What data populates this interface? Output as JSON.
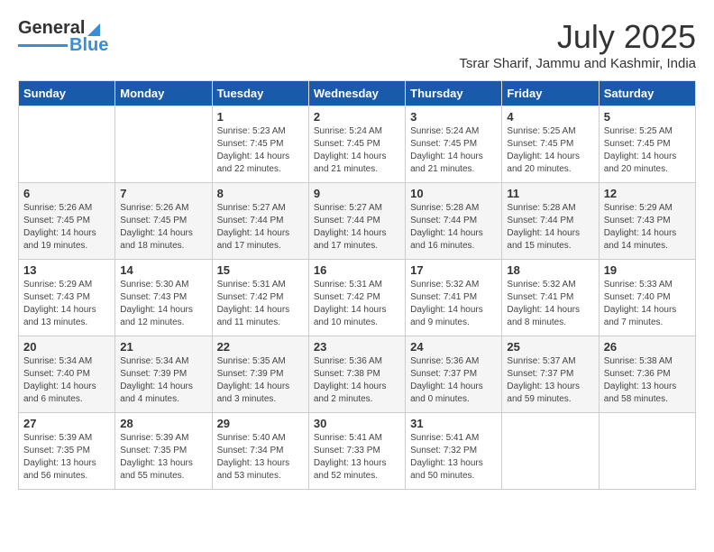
{
  "header": {
    "logo_line1": "General",
    "logo_line2": "Blue",
    "month_year": "July 2025",
    "location": "Tsrar Sharif, Jammu and Kashmir, India"
  },
  "days_of_week": [
    "Sunday",
    "Monday",
    "Tuesday",
    "Wednesday",
    "Thursday",
    "Friday",
    "Saturday"
  ],
  "weeks": [
    [
      {
        "day": "",
        "content": ""
      },
      {
        "day": "",
        "content": ""
      },
      {
        "day": "1",
        "content": "Sunrise: 5:23 AM\nSunset: 7:45 PM\nDaylight: 14 hours\nand 22 minutes."
      },
      {
        "day": "2",
        "content": "Sunrise: 5:24 AM\nSunset: 7:45 PM\nDaylight: 14 hours\nand 21 minutes."
      },
      {
        "day": "3",
        "content": "Sunrise: 5:24 AM\nSunset: 7:45 PM\nDaylight: 14 hours\nand 21 minutes."
      },
      {
        "day": "4",
        "content": "Sunrise: 5:25 AM\nSunset: 7:45 PM\nDaylight: 14 hours\nand 20 minutes."
      },
      {
        "day": "5",
        "content": "Sunrise: 5:25 AM\nSunset: 7:45 PM\nDaylight: 14 hours\nand 20 minutes."
      }
    ],
    [
      {
        "day": "6",
        "content": "Sunrise: 5:26 AM\nSunset: 7:45 PM\nDaylight: 14 hours\nand 19 minutes."
      },
      {
        "day": "7",
        "content": "Sunrise: 5:26 AM\nSunset: 7:45 PM\nDaylight: 14 hours\nand 18 minutes."
      },
      {
        "day": "8",
        "content": "Sunrise: 5:27 AM\nSunset: 7:44 PM\nDaylight: 14 hours\nand 17 minutes."
      },
      {
        "day": "9",
        "content": "Sunrise: 5:27 AM\nSunset: 7:44 PM\nDaylight: 14 hours\nand 17 minutes."
      },
      {
        "day": "10",
        "content": "Sunrise: 5:28 AM\nSunset: 7:44 PM\nDaylight: 14 hours\nand 16 minutes."
      },
      {
        "day": "11",
        "content": "Sunrise: 5:28 AM\nSunset: 7:44 PM\nDaylight: 14 hours\nand 15 minutes."
      },
      {
        "day": "12",
        "content": "Sunrise: 5:29 AM\nSunset: 7:43 PM\nDaylight: 14 hours\nand 14 minutes."
      }
    ],
    [
      {
        "day": "13",
        "content": "Sunrise: 5:29 AM\nSunset: 7:43 PM\nDaylight: 14 hours\nand 13 minutes."
      },
      {
        "day": "14",
        "content": "Sunrise: 5:30 AM\nSunset: 7:43 PM\nDaylight: 14 hours\nand 12 minutes."
      },
      {
        "day": "15",
        "content": "Sunrise: 5:31 AM\nSunset: 7:42 PM\nDaylight: 14 hours\nand 11 minutes."
      },
      {
        "day": "16",
        "content": "Sunrise: 5:31 AM\nSunset: 7:42 PM\nDaylight: 14 hours\nand 10 minutes."
      },
      {
        "day": "17",
        "content": "Sunrise: 5:32 AM\nSunset: 7:41 PM\nDaylight: 14 hours\nand 9 minutes."
      },
      {
        "day": "18",
        "content": "Sunrise: 5:32 AM\nSunset: 7:41 PM\nDaylight: 14 hours\nand 8 minutes."
      },
      {
        "day": "19",
        "content": "Sunrise: 5:33 AM\nSunset: 7:40 PM\nDaylight: 14 hours\nand 7 minutes."
      }
    ],
    [
      {
        "day": "20",
        "content": "Sunrise: 5:34 AM\nSunset: 7:40 PM\nDaylight: 14 hours\nand 6 minutes."
      },
      {
        "day": "21",
        "content": "Sunrise: 5:34 AM\nSunset: 7:39 PM\nDaylight: 14 hours\nand 4 minutes."
      },
      {
        "day": "22",
        "content": "Sunrise: 5:35 AM\nSunset: 7:39 PM\nDaylight: 14 hours\nand 3 minutes."
      },
      {
        "day": "23",
        "content": "Sunrise: 5:36 AM\nSunset: 7:38 PM\nDaylight: 14 hours\nand 2 minutes."
      },
      {
        "day": "24",
        "content": "Sunrise: 5:36 AM\nSunset: 7:37 PM\nDaylight: 14 hours\nand 0 minutes."
      },
      {
        "day": "25",
        "content": "Sunrise: 5:37 AM\nSunset: 7:37 PM\nDaylight: 13 hours\nand 59 minutes."
      },
      {
        "day": "26",
        "content": "Sunrise: 5:38 AM\nSunset: 7:36 PM\nDaylight: 13 hours\nand 58 minutes."
      }
    ],
    [
      {
        "day": "27",
        "content": "Sunrise: 5:39 AM\nSunset: 7:35 PM\nDaylight: 13 hours\nand 56 minutes."
      },
      {
        "day": "28",
        "content": "Sunrise: 5:39 AM\nSunset: 7:35 PM\nDaylight: 13 hours\nand 55 minutes."
      },
      {
        "day": "29",
        "content": "Sunrise: 5:40 AM\nSunset: 7:34 PM\nDaylight: 13 hours\nand 53 minutes."
      },
      {
        "day": "30",
        "content": "Sunrise: 5:41 AM\nSunset: 7:33 PM\nDaylight: 13 hours\nand 52 minutes."
      },
      {
        "day": "31",
        "content": "Sunrise: 5:41 AM\nSunset: 7:32 PM\nDaylight: 13 hours\nand 50 minutes."
      },
      {
        "day": "",
        "content": ""
      },
      {
        "day": "",
        "content": ""
      }
    ]
  ]
}
